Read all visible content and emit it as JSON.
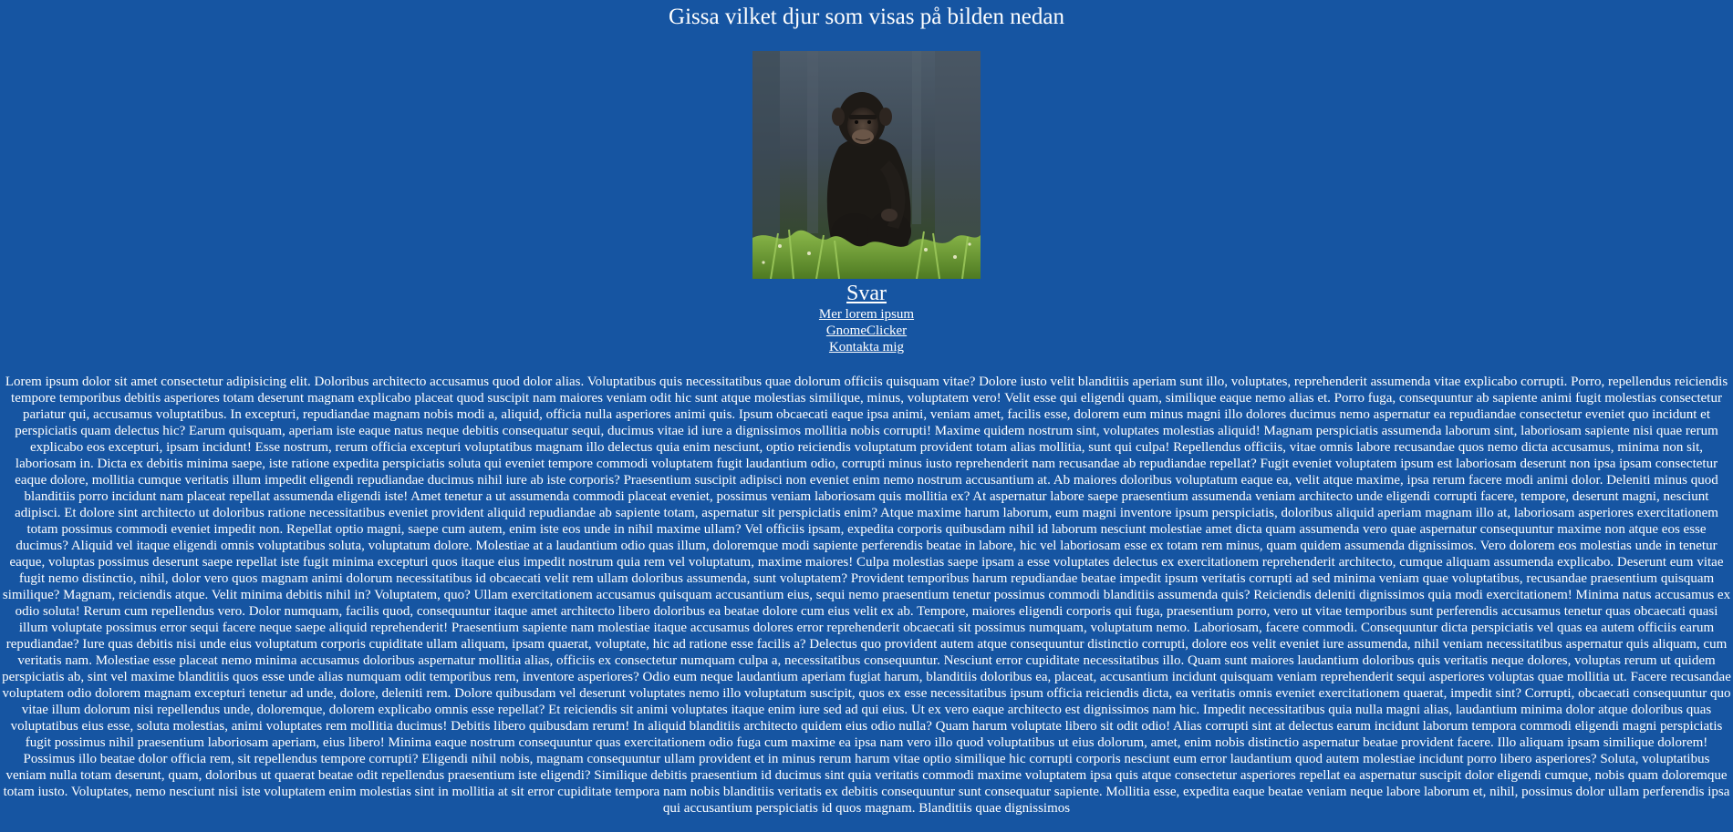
{
  "page": {
    "title": "Gissa vilket djur som visas på bilden nedan"
  },
  "image": {
    "subject": "chimpanzee-photo",
    "colors": {
      "sky": "#4a5a68",
      "fur": "#1d1a17",
      "grass": "#5d8a2e"
    }
  },
  "answer": {
    "label": "Svar"
  },
  "links": [
    {
      "label": "Mer lorem ipsum"
    },
    {
      "label": "GnomeClicker"
    },
    {
      "label": "Kontakta mig"
    }
  ],
  "lorem": {
    "text": "Lorem ipsum dolor sit amet consectetur adipisicing elit. Doloribus architecto accusamus quod dolor alias. Voluptatibus quis necessitatibus quae dolorum officiis quisquam vitae? Dolore iusto velit blanditiis aperiam sunt illo, voluptates, reprehenderit assumenda vitae explicabo corrupti. Porro, repellendus reiciendis tempore temporibus debitis asperiores totam deserunt magnam explicabo placeat quod suscipit nam maiores veniam odit hic sunt atque molestias similique, minus, voluptatem vero! Velit esse qui eligendi quam, similique eaque nemo alias et. Porro fuga, consequuntur ab sapiente animi fugit molestias consectetur pariatur qui, accusamus voluptatibus. In excepturi, repudiandae magnam nobis modi a, aliquid, officia nulla asperiores animi quis. Ipsum obcaecati eaque ipsa animi, veniam amet, facilis esse, dolorem eum minus magni illo dolores ducimus nemo aspernatur ea repudiandae consectetur eveniet quo incidunt et perspiciatis quam delectus hic? Earum quisquam, aperiam iste eaque natus neque debitis consequatur sequi, ducimus vitae id iure a dignissimos mollitia nobis corrupti! Maxime quidem nostrum sint, voluptates molestias aliquid! Magnam perspiciatis assumenda laborum sint, laboriosam sapiente nisi quae rerum explicabo eos excepturi, ipsam incidunt! Esse nostrum, rerum officia excepturi voluptatibus magnam illo delectus quia enim nesciunt, optio reiciendis voluptatum provident totam alias mollitia, sunt qui culpa! Repellendus officiis, vitae omnis labore recusandae quos nemo dicta accusamus, minima non sit, laboriosam in. Dicta ex debitis minima saepe, iste ratione expedita perspiciatis soluta qui eveniet tempore commodi voluptatem fugit laudantium odio, corrupti minus iusto reprehenderit nam recusandae ab repudiandae repellat? Fugit eveniet voluptatem ipsum est laboriosam deserunt non ipsa ipsam consectetur eaque dolore, mollitia cumque veritatis illum impedit eligendi repudiandae ducimus nihil iure ab iste corporis? Praesentium suscipit adipisci non eveniet enim nemo nostrum accusantium at. Ab maiores doloribus voluptatum eaque ea, velit atque maxime, ipsa rerum facere modi animi dolor. Deleniti minus quod blanditiis porro incidunt nam placeat repellat assumenda eligendi iste! Amet tenetur a ut assumenda commodi placeat eveniet, possimus veniam laboriosam quis mollitia ex? At aspernatur labore saepe praesentium assumenda veniam architecto unde eligendi corrupti facere, tempore, deserunt magni, nesciunt adipisci. Et dolore sint architecto ut doloribus ratione necessitatibus eveniet provident aliquid repudiandae ab sapiente totam, aspernatur sit perspiciatis enim? Atque maxime harum laborum, eum magni inventore ipsum perspiciatis, doloribus aliquid aperiam magnam illo at, laboriosam asperiores exercitationem totam possimus commodi eveniet impedit non. Repellat optio magni, saepe cum autem, enim iste eos unde in nihil maxime ullam? Vel officiis ipsam, expedita corporis quibusdam nihil id laborum nesciunt molestiae amet dicta quam assumenda vero quae aspernatur consequuntur maxime non atque eos esse ducimus? Aliquid vel itaque eligendi omnis voluptatibus soluta, voluptatum dolore. Molestiae at a laudantium odio quas illum, doloremque modi sapiente perferendis beatae in labore, hic vel laboriosam esse ex totam rem minus, quam quidem assumenda dignissimos. Vero dolorem eos molestias unde in tenetur eaque, voluptas possimus deserunt saepe repellat iste fugit minima excepturi quos itaque eius impedit nostrum quia rem vel voluptatum, maxime maiores! Culpa molestias saepe ipsam a esse voluptates delectus ex exercitationem reprehenderit architecto, cumque aliquam assumenda explicabo. Deserunt eum vitae fugit nemo distinctio, nihil, dolor vero quos magnam animi dolorum necessitatibus id obcaecati velit rem ullam doloribus assumenda, sunt voluptatem? Provident temporibus harum repudiandae beatae impedit ipsum veritatis corrupti ad sed minima veniam quae voluptatibus, recusandae praesentium quisquam similique? Magnam, reiciendis atque. Velit minima debitis nihil in? Voluptatem, quo? Ullam exercitationem accusamus quisquam accusantium eius, sequi nemo praesentium tenetur possimus commodi blanditiis assumenda quis? Reiciendis deleniti dignissimos quia modi exercitationem! Minima natus accusamus ex odio soluta! Rerum cum repellendus vero. Dolor numquam, facilis quod, consequuntur itaque amet architecto libero doloribus ea beatae dolore cum eius velit ex ab. Tempore, maiores eligendi corporis qui fuga, praesentium porro, vero ut vitae temporibus sunt perferendis accusamus tenetur quas obcaecati quasi illum voluptate possimus error sequi facere neque saepe aliquid reprehenderit! Praesentium sapiente nam molestiae itaque accusamus dolores error reprehenderit obcaecati sit possimus numquam, voluptatum nemo. Laboriosam, facere commodi. Consequuntur dicta perspiciatis vel quas ea autem officiis earum repudiandae? Iure quas debitis nisi unde eius voluptatum corporis cupiditate ullam aliquam, ipsam quaerat, voluptate, hic ad ratione esse facilis a? Delectus quo provident autem atque consequuntur distinctio corrupti, dolore eos velit eveniet iure assumenda, nihil veniam necessitatibus aspernatur quis aliquam, cum veritatis nam. Molestiae esse placeat nemo minima accusamus doloribus aspernatur mollitia alias, officiis ex consectetur numquam culpa a, necessitatibus consequuntur. Nesciunt error cupiditate necessitatibus illo. Quam sunt maiores laudantium doloribus quis veritatis neque dolores, voluptas rerum ut quidem perspiciatis ab, sint vel maxime blanditiis quos esse unde alias numquam odit temporibus rem, inventore asperiores? Odio eum neque laudantium aperiam fugiat harum, blanditiis doloribus ea, placeat, accusantium incidunt quisquam veniam reprehenderit sequi asperiores voluptas quae mollitia ut. Facere recusandae voluptatem odio dolorem magnam excepturi tenetur ad unde, dolore, deleniti rem. Dolore quibusdam vel deserunt voluptates nemo illo voluptatum suscipit, quos ex esse necessitatibus ipsum officia reiciendis dicta, ea veritatis omnis eveniet exercitationem quaerat, impedit sint? Corrupti, obcaecati consequuntur quo vitae illum dolorum nisi repellendus unde, doloremque, dolorem explicabo omnis esse repellat? Et reiciendis sit animi voluptates itaque enim iure sed ad qui eius. Ut ex vero eaque architecto est dignissimos nam hic. Impedit necessitatibus quia nulla magni alias, laudantium minima dolor atque doloribus quas voluptatibus eius esse, soluta molestias, animi voluptates rem mollitia ducimus! Debitis libero quibusdam rerum! In aliquid blanditiis architecto quidem eius odio nulla? Quam harum voluptate libero sit odit odio! Alias corrupti sint at delectus earum incidunt laborum tempora commodi eligendi magni perspiciatis fugit possimus nihil praesentium laboriosam aperiam, eius libero! Minima eaque nostrum consequuntur quas exercitationem odio fuga cum maxime ea ipsa nam vero illo quod voluptatibus ut eius dolorum, amet, enim nobis distinctio aspernatur beatae provident facere. Illo aliquam ipsam similique dolorem! Possimus illo beatae dolor officia rem, sit repellendus tempore corrupti? Eligendi nihil nobis, magnam consequuntur ullam provident et in minus rerum harum vitae optio similique hic corrupti corporis nesciunt eum error laudantium quod autem molestiae incidunt porro libero asperiores? Soluta, voluptatibus veniam nulla totam deserunt, quam, doloribus ut quaerat beatae odit repellendus praesentium iste eligendi? Similique debitis praesentium id ducimus sint quia veritatis commodi maxime voluptatem ipsa quis atque consectetur asperiores repellat ea aspernatur suscipit dolor eligendi cumque, nobis quam doloremque totam iusto. Voluptates, nemo nesciunt nisi iste voluptatem enim molestias sint in mollitia at sit error cupiditate tempora nam nobis blanditiis veritatis ex debitis consequuntur sunt consequatur sapiente. Mollitia esse, expedita eaque beatae veniam neque labore laborum et, nihil, possimus dolor ullam perferendis ipsa qui accusantium perspiciatis id quos magnam. Blanditiis quae dignissimos"
  }
}
